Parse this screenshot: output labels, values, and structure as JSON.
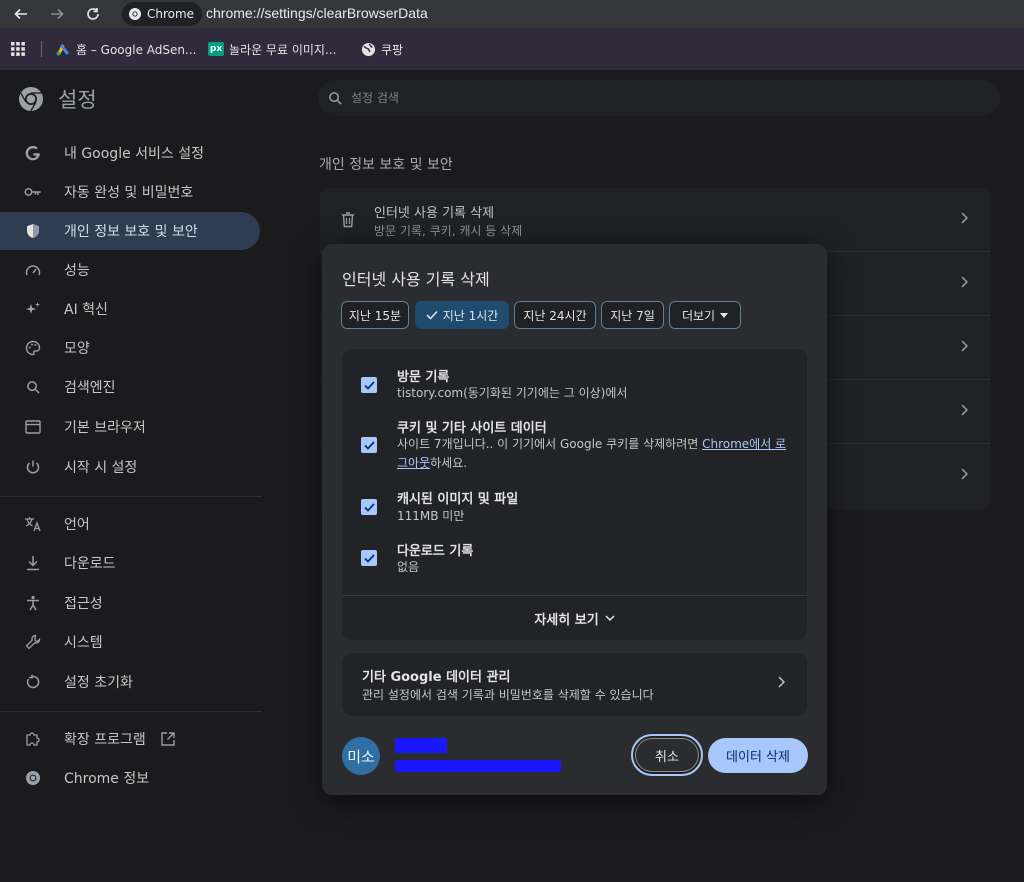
{
  "browser": {
    "chip_label": "Chrome",
    "url": "chrome://settings/clearBrowserData",
    "bookmarks": [
      {
        "label": "홈 – Google AdSen..."
      },
      {
        "label": "놀라운 무료 이미지..."
      },
      {
        "label": "쿠팡"
      }
    ],
    "pexels_badge": "px"
  },
  "settings": {
    "title": "설정",
    "search_placeholder": "설정 검색",
    "sidebar": {
      "items": [
        {
          "label": "내 Google 서비스 설정",
          "icon": "google-g-icon"
        },
        {
          "label": "자동 완성 및 비밀번호",
          "icon": "key-icon"
        },
        {
          "label": "개인 정보 보호 및 보안",
          "icon": "shield-icon",
          "active": true
        },
        {
          "label": "성능",
          "icon": "speedometer-icon"
        },
        {
          "label": "AI 혁신",
          "icon": "sparkle-icon"
        },
        {
          "label": "모양",
          "icon": "palette-icon"
        },
        {
          "label": "검색엔진",
          "icon": "search-icon"
        },
        {
          "label": "기본 브라우저",
          "icon": "browser-window-icon"
        },
        {
          "label": "시작 시 설정",
          "icon": "power-icon"
        },
        {
          "label": "언어",
          "icon": "translate-icon"
        },
        {
          "label": "다운로드",
          "icon": "download-icon"
        },
        {
          "label": "접근성",
          "icon": "accessibility-icon"
        },
        {
          "label": "시스템",
          "icon": "wrench-icon"
        },
        {
          "label": "설정 초기화",
          "icon": "reset-icon"
        },
        {
          "label": "확장 프로그램",
          "icon": "puzzle-icon"
        },
        {
          "label": "Chrome 정보",
          "icon": "chrome-icon"
        }
      ]
    },
    "main": {
      "heading": "개인 정보 보호 및 보안",
      "first_row": {
        "title": "인터넷 사용 기록 삭제",
        "subtitle": "방문 기록, 쿠키, 캐시 등 삭제"
      }
    }
  },
  "dialog": {
    "title": "인터넷 사용 기록 삭제",
    "time_ranges": [
      {
        "label": "지난 15분"
      },
      {
        "label": "지난 1시간",
        "selected": true
      },
      {
        "label": "지난 24시간"
      },
      {
        "label": "지난 7일"
      },
      {
        "label": "더보기"
      }
    ],
    "options": [
      {
        "title": "방문 기록",
        "subtitle": "tistory.com(동기화된 기기에는 그 이상)에서",
        "checked": true
      },
      {
        "title": "쿠키 및 기타 사이트 데이터",
        "subtitle_before": "사이트 7개입니다.. 이 기기에서 Google 쿠키를 삭제하려면 ",
        "subtitle_link": "Chrome에서 로그아웃",
        "subtitle_after": "하세요.",
        "checked": true
      },
      {
        "title": "캐시된 이미지 및 파일",
        "subtitle": "111MB 미만",
        "checked": true
      },
      {
        "title": "다운로드 기록",
        "subtitle": "없음",
        "checked": true
      }
    ],
    "more_label": "자세히 보기",
    "google_data": {
      "title": "기타 Google 데이터 관리",
      "subtitle": "관리 설정에서 검색 기록과 비밀번호를 삭제할 수 있습니다"
    },
    "account": {
      "avatar_text": "미소"
    },
    "cancel_label": "취소",
    "delete_label": "데이터 삭제"
  }
}
